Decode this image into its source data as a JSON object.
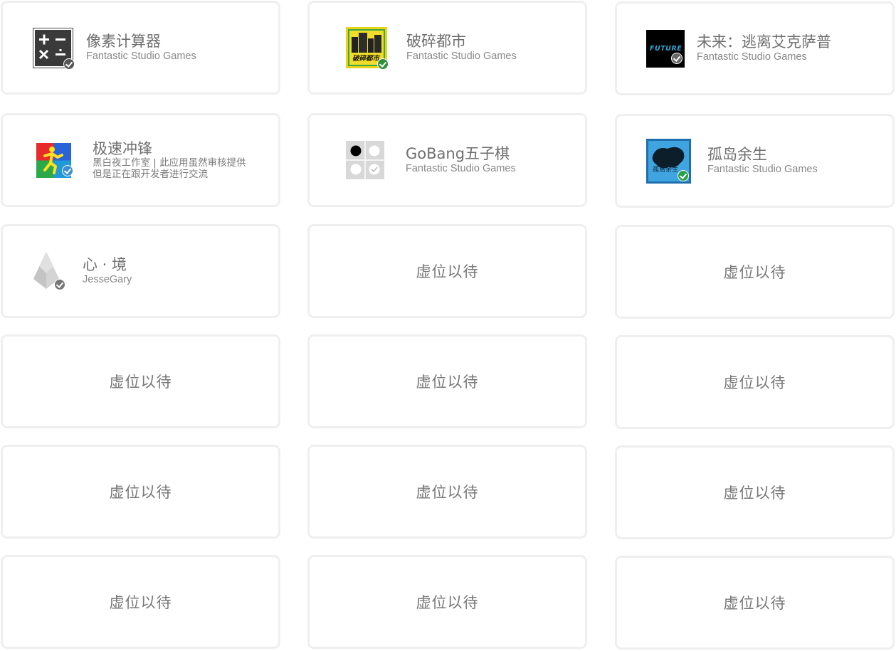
{
  "apps": [
    {
      "title": "像素计算器",
      "subtitle": "Fantastic Studio Games",
      "icon": "calculator-icon"
    },
    {
      "title": "破碎都市",
      "subtitle": "Fantastic Studio Games",
      "icon": "broken-city-icon",
      "icon_text": "破碎都市"
    },
    {
      "title": "未来：逃离艾克萨普",
      "subtitle": "Fantastic Studio Games",
      "icon": "future-icon",
      "icon_text": "FUTURE"
    },
    {
      "title": "极速冲锋",
      "subtitle_lines": [
        "黑白夜工作室 | 此应用虽然审核提供",
        "但是正在跟开发者进行交流"
      ],
      "icon": "running-man-icon"
    },
    {
      "title": "GoBang五子棋",
      "subtitle": "Fantastic Studio Games",
      "icon": "gobang-icon"
    },
    {
      "title": "孤岛余生",
      "subtitle": "Fantastic Studio Games",
      "icon": "island-icon",
      "icon_text": "孤島余生"
    },
    {
      "title": "心 · 境",
      "subtitle": "JesseGary",
      "icon": "crystal-icon"
    }
  ],
  "placeholder_label": "虚位以待",
  "colors": {
    "card_border": "#efefef",
    "title": "#6f6f6f",
    "subtitle": "#888888",
    "placeholder": "#777777"
  }
}
